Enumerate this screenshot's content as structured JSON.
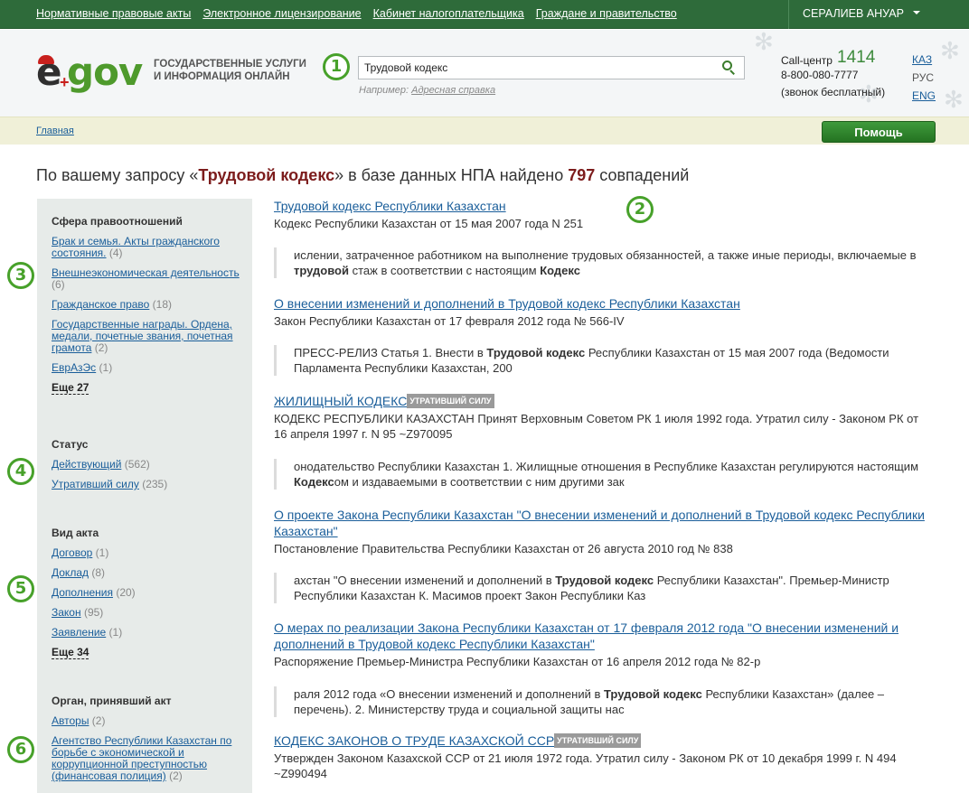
{
  "top_nav": {
    "links": [
      "Нормативные правовые акты",
      "Электронное лицензирование",
      "Кабинет налогоплательщика",
      "Граждане и правительство"
    ],
    "user_name": "СЕРАЛИЕВ АНУАР"
  },
  "header": {
    "logo_e": "e",
    "logo_plus": "+",
    "logo_gov": "gov",
    "tagline_line1": "ГОСУДАРСТВЕННЫЕ УСЛУГИ",
    "tagline_line2": "И ИНФОРМАЦИЯ ОНЛАЙН",
    "search_value": "Трудовой кодекс",
    "example_label": "Например:",
    "example_link": "Адресная справка",
    "callcenter_label": "Call-центр",
    "callcenter_number": "1414",
    "callcenter_phone": "8-800-080-7777",
    "callcenter_note": "(звонок бесплатный)",
    "langs": [
      "КАЗ",
      "РУС",
      "ENG"
    ]
  },
  "markers": [
    "1",
    "2",
    "3",
    "4",
    "5",
    "6"
  ],
  "breadcrumb": "Главная",
  "help_button": "Помощь",
  "results_heading": {
    "prefix": "По вашему запросу «",
    "query": "Трудовой кодекс",
    "middle": "» в базе данных НПА найдено ",
    "count": "797",
    "suffix": " совпадений"
  },
  "facets": [
    {
      "title": "Сфера правоотношений",
      "items": [
        {
          "label": "Брак и семья. Акты гражданского состояния.",
          "count": "(4)"
        },
        {
          "label": "Внешнеэкономическая деятельность",
          "count": "(6)"
        },
        {
          "label": "Гражданское право",
          "count": "(18)"
        },
        {
          "label": "Государственные награды. Ордена, медали, почетные звания, почетная грамота",
          "count": "(2)"
        },
        {
          "label": "ЕврАзЭс",
          "count": "(1)"
        }
      ],
      "more": "Еще 27"
    },
    {
      "title": "Статус",
      "items": [
        {
          "label": "Действующий",
          "count": "(562)"
        },
        {
          "label": "Утративший силу",
          "count": "(235)"
        }
      ],
      "more": ""
    },
    {
      "title": "Вид акта",
      "items": [
        {
          "label": "Договор",
          "count": "(1)"
        },
        {
          "label": "Доклад",
          "count": "(8)"
        },
        {
          "label": "Дополнения",
          "count": "(20)"
        },
        {
          "label": "Закон",
          "count": "(95)"
        },
        {
          "label": "Заявление",
          "count": "(1)"
        }
      ],
      "more": "Еще 34"
    },
    {
      "title": "Орган, принявший акт",
      "items": [
        {
          "label": "Авторы",
          "count": "(2)"
        },
        {
          "label": "Агентство Республики Казахстан по борьбе с экономической и коррупционной преступностью (финансовая полиция)",
          "count": "(2)"
        }
      ],
      "more": ""
    }
  ],
  "results": [
    {
      "title": "Трудовой кодекс Республики Казахстан",
      "badge": "",
      "desc": "Кодекс Республики Казахстан от 15 мая 2007 года N 251",
      "snippet": [
        {
          "t": "ислении, затраченное работником на выполнение трудовых обязанностей, а также иные периоды, включаемые в ",
          "b": false
        },
        {
          "t": "трудовой",
          "b": true
        },
        {
          "t": " стаж в соответствии с настоящим ",
          "b": false
        },
        {
          "t": "Кодекс",
          "b": true
        }
      ]
    },
    {
      "title": "О внесении изменений и дополнений в Трудовой кодекс Республики Казахстан",
      "badge": "",
      "desc": "Закон Республики Казахстан от 17 февраля 2012 года № 566-IV",
      "snippet": [
        {
          "t": "ПРЕСС-РЕЛИЗ Статья 1. Внести в ",
          "b": false
        },
        {
          "t": "Трудовой кодекс",
          "b": true
        },
        {
          "t": " Республики Казахстан от 15 мая 2007 года (Ведомости Парламента Республики Казахстан, 200",
          "b": false
        }
      ]
    },
    {
      "title": "ЖИЛИЩНЫЙ КОДЕКС",
      "badge": "УТРАТИВШИЙ СИЛУ",
      "desc": "КОДЕКС РЕСПУБЛИКИ КАЗАХСТАН Принят Верховным Советом РК 1 июля 1992 года. Утратил силу - Законом РК от 16 апреля 1997 г. N 95 ~Z970095",
      "snippet": [
        {
          "t": "онодательство Республики Казахстан 1. Жилищные отношения в Республике Казахстан регулируются настоящим ",
          "b": false
        },
        {
          "t": "Кодекс",
          "b": true
        },
        {
          "t": "ом и издаваемыми в соответствии с ним другими зак",
          "b": false
        }
      ]
    },
    {
      "title": "О проекте Закона Республики Казахстан \"О внесении изменений и дополнений в Трудовой кодекс Республики Казахстан\"",
      "badge": "",
      "desc": "Постановление Правительства Республики Казахстан от 26 августа 2010 год № 838",
      "snippet": [
        {
          "t": "ахстан \"О внесении изменений и дополнений в ",
          "b": false
        },
        {
          "t": "Трудовой кодекс",
          "b": true
        },
        {
          "t": " Республики Казахстан\". Премьер-Министр Республики Казахстан К. Масимов проект Закон Республики Каз",
          "b": false
        }
      ]
    },
    {
      "title": "О мерах по реализации Закона Республики Казахстан от 17 февраля 2012 года \"О внесении изменений и дополнений в Трудовой кодекс Республики Казахстан\"",
      "badge": "",
      "desc": "Распоряжение Премьер-Министра Республики Казахстан от 16 апреля 2012 года № 82-р",
      "snippet": [
        {
          "t": "раля 2012 года «О внесении изменений и дополнений в ",
          "b": false
        },
        {
          "t": "Трудовой кодекс",
          "b": true
        },
        {
          "t": " Республики Казахстан» (далее – перечень). 2. Министерству труда и социальной защиты нас",
          "b": false
        }
      ]
    },
    {
      "title": "КОДЕКС ЗАКОНОВ О ТРУДЕ КАЗАХСКОЙ ССР",
      "badge": "УТРАТИВШИЙ СИЛУ",
      "desc": "Утвержден Законом Казахской ССР от 21 июля 1972 года. Утратил силу - Законом РК от 10 декабря 1999 г. N 494 ~Z990494",
      "snippet": []
    }
  ]
}
